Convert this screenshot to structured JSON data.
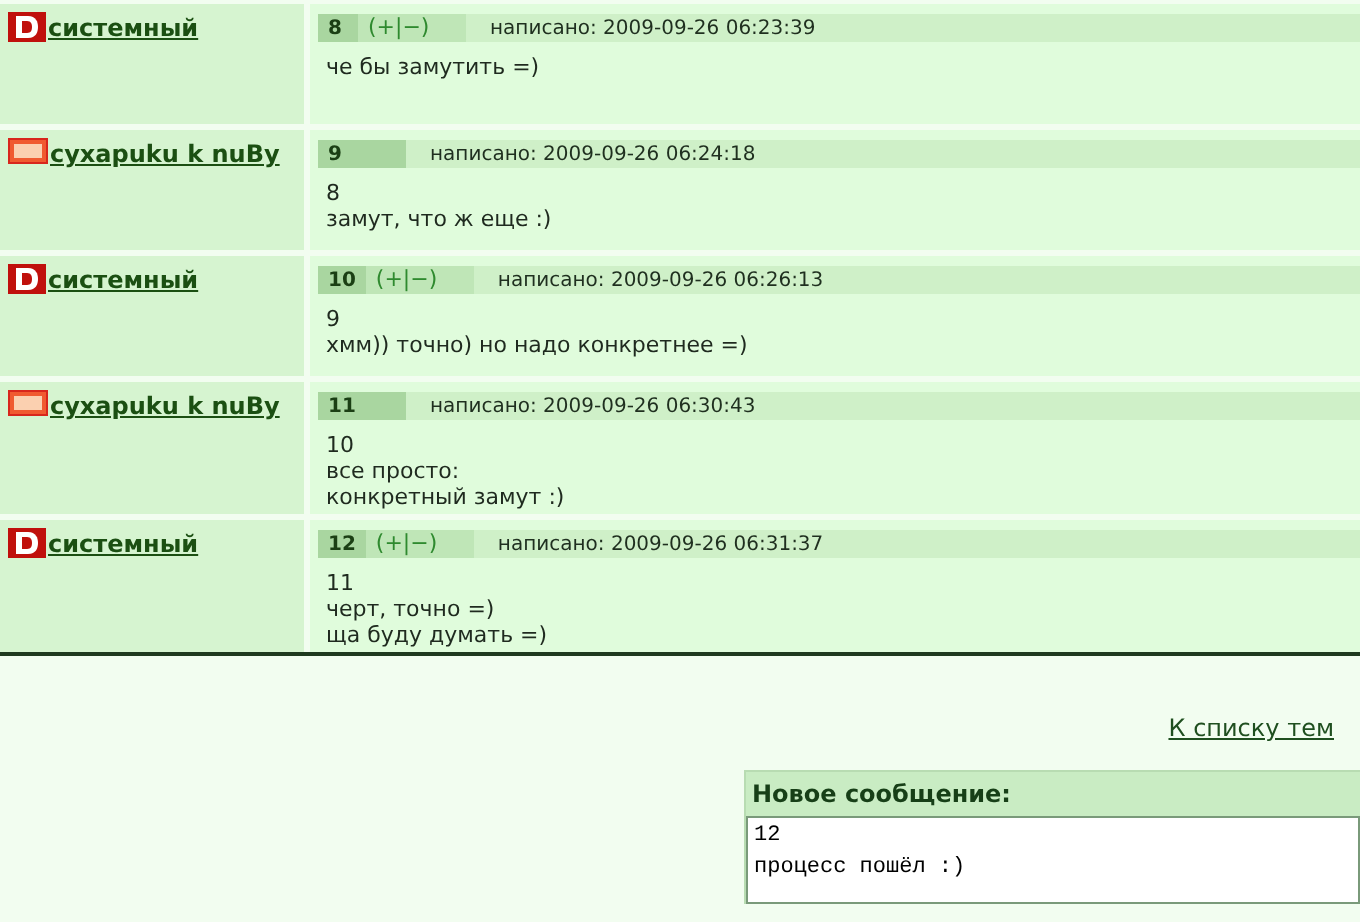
{
  "posts": [
    {
      "kind": "admin",
      "author": "системный",
      "number": "8",
      "vote": "(+|−)",
      "posted": "написано: 2009-09-26 06:23:39",
      "lines": [
        "че бы замутить =)"
      ]
    },
    {
      "kind": "user",
      "author": "cyxapuku k nuBy",
      "number": "9",
      "posted": "написано: 2009-09-26 06:24:18",
      "lines": [
        "8",
        "замут, что ж еще :)"
      ]
    },
    {
      "kind": "admin",
      "author": "системный",
      "number": "10",
      "vote": "(+|−)",
      "posted": "написано: 2009-09-26 06:26:13",
      "lines": [
        "9",
        "хмм)) точно) но надо конкретнее =)"
      ]
    },
    {
      "kind": "user",
      "author": "cyxapuku k nuBy",
      "number": "11",
      "posted": "написано: 2009-09-26 06:30:43",
      "lines": [
        "10",
        "все просто:",
        "конкретный замут :)"
      ]
    },
    {
      "kind": "admin",
      "author": "системный",
      "number": "12",
      "vote": "(+|−)",
      "posted": "написано: 2009-09-26 06:31:37",
      "lines": [
        "11",
        "черт, точно =)",
        "ща буду думать =)"
      ]
    }
  ],
  "back_link": "К списку тем",
  "new_message": {
    "title": "Новое сообщение:",
    "value": "12\nпроцесс пошёл :)"
  }
}
